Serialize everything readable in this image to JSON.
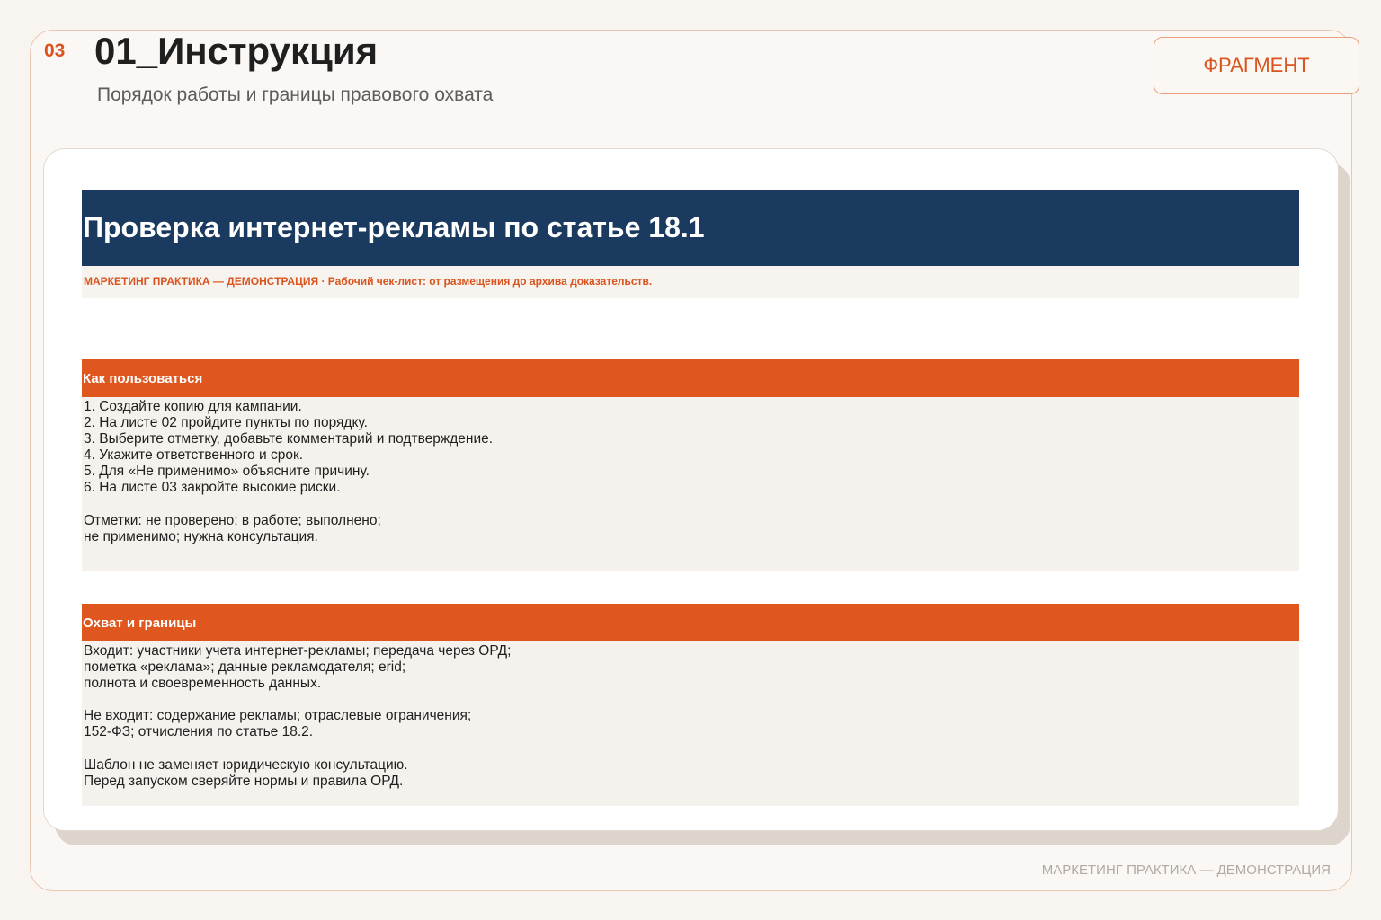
{
  "slide": {
    "number": "03",
    "title": "01_Инструкция",
    "subtitle": "Порядок работы и границы правового охвата",
    "badge": "ФРАГМЕНТ",
    "footer": "МАРКЕТИНГ ПРАКТИКА — ДЕМОНСТРАЦИЯ"
  },
  "sheet": {
    "title": "Проверка интернет-рекламы по статье 18.1",
    "caption": "МАРКЕТИНГ ПРАКТИКА — ДЕМОНСТРАЦИЯ · Рабочий чек-лист: от размещения до архива доказательств.",
    "sections": [
      {
        "heading": "Как пользоваться",
        "lines": [
          "1. Создайте копию для кампании.",
          "2. На листе 02 пройдите пункты по порядку.",
          "3. Выберите отметку, добавьте комментарий и подтверждение.",
          "4. Укажите ответственного и срок.",
          "5. Для «Не применимо» объясните причину.",
          "6. На листе 03 закройте высокие риски.",
          "",
          "Отметки: не проверено; в работе; выполнено;",
          "не применимо; нужна консультация."
        ]
      },
      {
        "heading": "Охват и границы",
        "lines": [
          "Входит: участники учета интернет-рекламы; передача через ОРД;",
          "пометка «реклама»; данные рекламодателя; erid;",
          "полнота и своевременность данных.",
          "",
          "Не входит: содержание рекламы; отраслевые ограничения;",
          "152-ФЗ; отчисления по статье 18.2.",
          "",
          "Шаблон не заменяет юридическую консультацию.",
          "Перед запуском сверяйте нормы и правила ОРД."
        ]
      }
    ]
  },
  "colors": {
    "accent": "#df561f",
    "navy": "#1b3a5f",
    "background": "#f8f5f1"
  }
}
